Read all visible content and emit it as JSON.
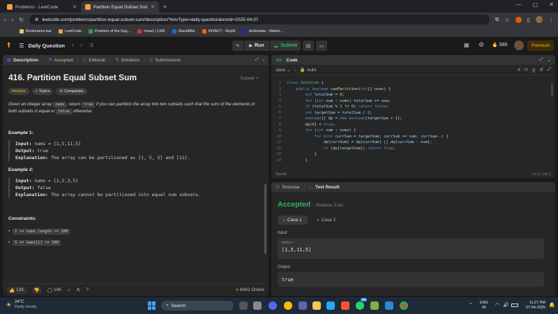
{
  "browser": {
    "tabs": [
      {
        "title": "Problems - LeetCode",
        "active": false
      },
      {
        "title": "Partition Equal Subset Sum - L",
        "active": true
      }
    ],
    "url": "leetcode.com/problems/partition-equal-subset-sum/description/?envType=daily-question&envid=2025-04-07",
    "bookmarks": [
      {
        "label": "Bookmarks bar",
        "color": "#f2c94c"
      },
      {
        "label": "LeetCode",
        "color": "#f0a33a"
      },
      {
        "label": "Problem of the Day...",
        "color": "#2f9e44"
      },
      {
        "label": "Invact | LMS",
        "color": "#e03131"
      },
      {
        "label": "StackBlitz",
        "color": "#1971c2"
      },
      {
        "label": "INVACT - Replit",
        "color": "#f76707"
      },
      {
        "label": "JioHotstar - Watch...",
        "color": "#1c2bbf"
      }
    ]
  },
  "nav": {
    "daily_question": "Daily Question",
    "run": "Run",
    "submit": "Submit",
    "streak": "560",
    "premium": "Premium"
  },
  "desc": {
    "tabs": [
      "Description",
      "Accepted",
      "Editorial",
      "Solutions",
      "Submissions"
    ],
    "title": "416. Partition Equal Subset Sum",
    "solved": "Solved",
    "chips": [
      "Medium",
      "Topics",
      "Companies"
    ],
    "statement": {
      "p1": "Given an integer array ",
      "c1": "nums",
      "p2": ", return ",
      "c2": "true",
      "p3": " if you can partition the array into two subsets such that the sum of the elements in both subsets is equal or ",
      "c3": "false",
      "p4": " otherwise."
    },
    "examples": [
      {
        "heading": "Example 1:",
        "input_label": "Input:",
        "input": "nums = [1,5,11,5]",
        "output_label": "Output:",
        "output": "true",
        "expl_label": "Explanation:",
        "expl": "The array can be partitioned as [1, 5, 5] and [11]."
      },
      {
        "heading": "Example 2:",
        "input_label": "Input:",
        "input": "nums = [1,2,3,5]",
        "output_label": "Output:",
        "output": "false",
        "expl_label": "Explanation:",
        "expl": "The array cannot be partitioned into equal sum subsets."
      }
    ],
    "constraints_heading": "Constraints:",
    "constraints": [
      "1 <= nums.length <= 200",
      "1 <= nums[i] <= 100"
    ],
    "likes": "13K",
    "comments": "196",
    "online": "6992 Online"
  },
  "code": {
    "header": "Code",
    "language": "Java",
    "mode": "Auto",
    "saved": "Saved",
    "position": "Ln 1, Col 1",
    "lines": [
      "class Solution {",
      "    public boolean canPartition(int[] nums) {",
      "        int totalSum = 0;",
      "        for (int num : nums) totalSum += num;",
      "        if (totalSum % 2 != 0) return false;",
      "        int targetSum = totalSum / 2;",
      "        boolean[] dp = new boolean[targetSum + 1];",
      "        dp[0] = true;",
      "        for (int num : nums) {",
      "            for (int currSum = targetSum; currSum >= num; currSum--) {",
      "                dp[currSum] = dp[currSum] || dp[currSum - num];",
      "                if (dp[targetSum]) return true;",
      "            }",
      "        }"
    ]
  },
  "result": {
    "tabs": [
      "Testcase",
      "Test Result"
    ],
    "status": "Accepted",
    "runtime": "Runtime: 0 ms",
    "cases": [
      "Case 1",
      "Case 2"
    ],
    "input_label": "Input",
    "var_label": "nums =",
    "input_value": "[1,5,11,5]",
    "output_label": "Output",
    "output_value": "true"
  },
  "taskbar": {
    "temp": "24°C",
    "weather": "Partly cloudy",
    "search": "Search",
    "lang1": "ENG",
    "lang2": "IN",
    "time": "11:27 PM",
    "date": "07-04-2025",
    "badge": "10"
  }
}
